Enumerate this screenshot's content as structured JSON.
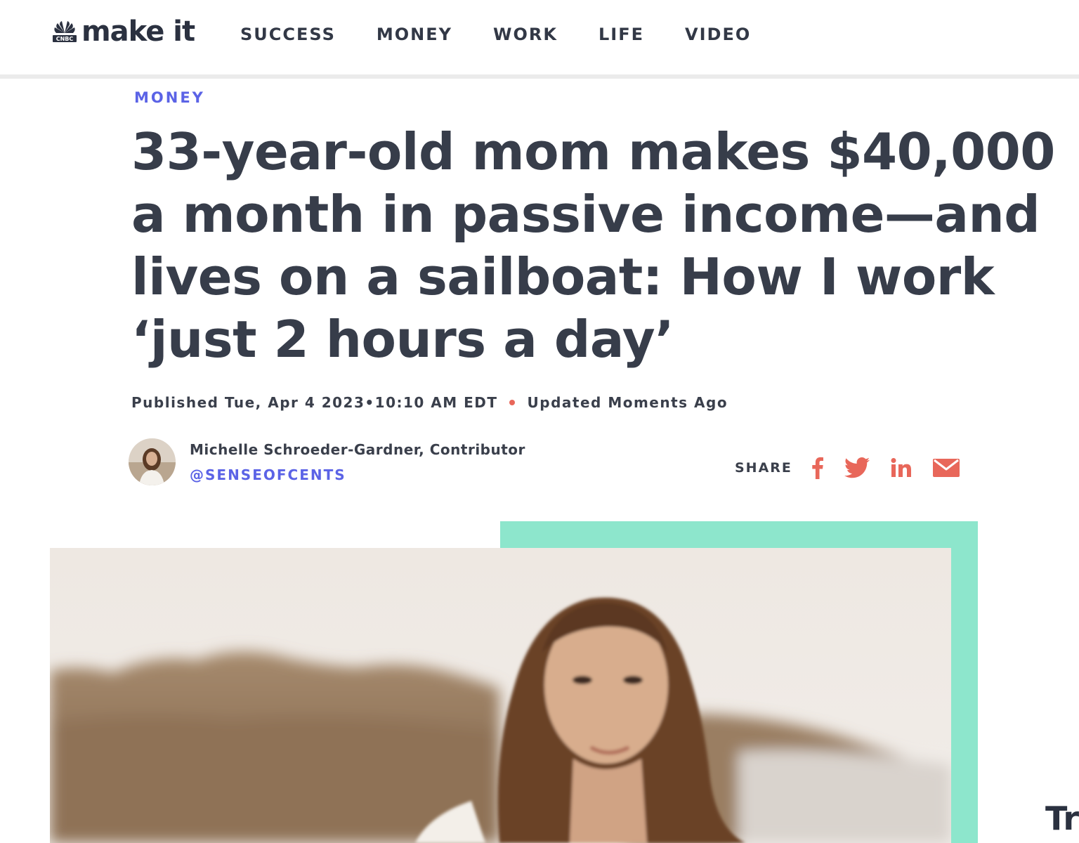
{
  "header": {
    "logo": {
      "network": "CNBC",
      "wordmark": "make it"
    },
    "nav": [
      {
        "label": "SUCCESS"
      },
      {
        "label": "MONEY"
      },
      {
        "label": "WORK"
      },
      {
        "label": "LIFE"
      },
      {
        "label": "VIDEO"
      }
    ]
  },
  "article": {
    "kicker": "MONEY",
    "headline": "33-year-old mom makes $40,000 a month in passive income—and lives on a sailboat: How I work ‘just 2 hours a day’",
    "published": "Published Tue, Apr 4 2023•10:10 AM EDT",
    "updated": "Updated Moments Ago",
    "author": {
      "name": "Michelle Schroeder-Gardner, Contributor",
      "handle": "@SENSEOFCENTS"
    },
    "share": {
      "label": "SHARE",
      "icons": [
        "facebook-icon",
        "twitter-icon",
        "linkedin-icon",
        "email-icon"
      ]
    }
  },
  "side_teaser": "Tr",
  "colors": {
    "accent": "#5b63e6",
    "share_icons": "#e8675a",
    "image_frame": "#8de6cc",
    "text": "#373d4a"
  }
}
